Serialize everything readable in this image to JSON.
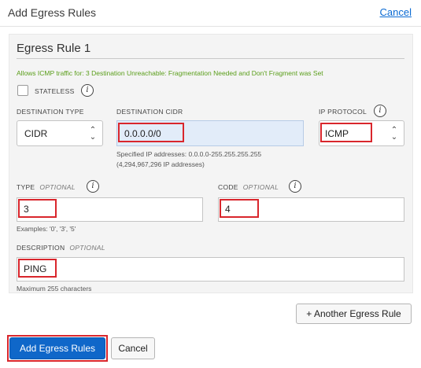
{
  "dialog": {
    "title": "Add Egress Rules",
    "cancel_link": "Cancel"
  },
  "rule": {
    "title": "Egress Rule 1",
    "info": "Allows ICMP traffic for: 3 Destination Unreachable: Fragmentation Needed and Don't Fragment was Set",
    "stateless_label": "STATELESS",
    "stateless_checked": false,
    "destination_type": {
      "label": "DESTINATION TYPE",
      "value": "CIDR"
    },
    "destination_cidr": {
      "label": "DESTINATION CIDR",
      "value": "0.0.0.0/0",
      "help_line1": "Specified IP addresses: 0.0.0.0-255.255.255.255",
      "help_line2": "(4,294,967,296 IP addresses)"
    },
    "ip_protocol": {
      "label": "IP PROTOCOL",
      "value": "ICMP"
    },
    "type": {
      "label": "TYPE",
      "optional": "OPTIONAL",
      "value": "3",
      "help": "Examples: '0', '3', '5'"
    },
    "code": {
      "label": "CODE",
      "optional": "OPTIONAL",
      "value": "4"
    },
    "description": {
      "label": "DESCRIPTION",
      "optional": "OPTIONAL",
      "value": "PING",
      "help": "Maximum 255 characters"
    }
  },
  "another_rule_button": "+ Another Egress Rule",
  "footer": {
    "primary": "Add Egress Rules",
    "cancel": "Cancel"
  },
  "icons": {
    "info": "i",
    "caret_up": "⌃",
    "caret_down": "⌄"
  },
  "colors": {
    "highlight_border": "#d9262c",
    "primary_button": "#0f67c9",
    "link": "#0a6ad3",
    "info_text": "#5a9e1a"
  }
}
